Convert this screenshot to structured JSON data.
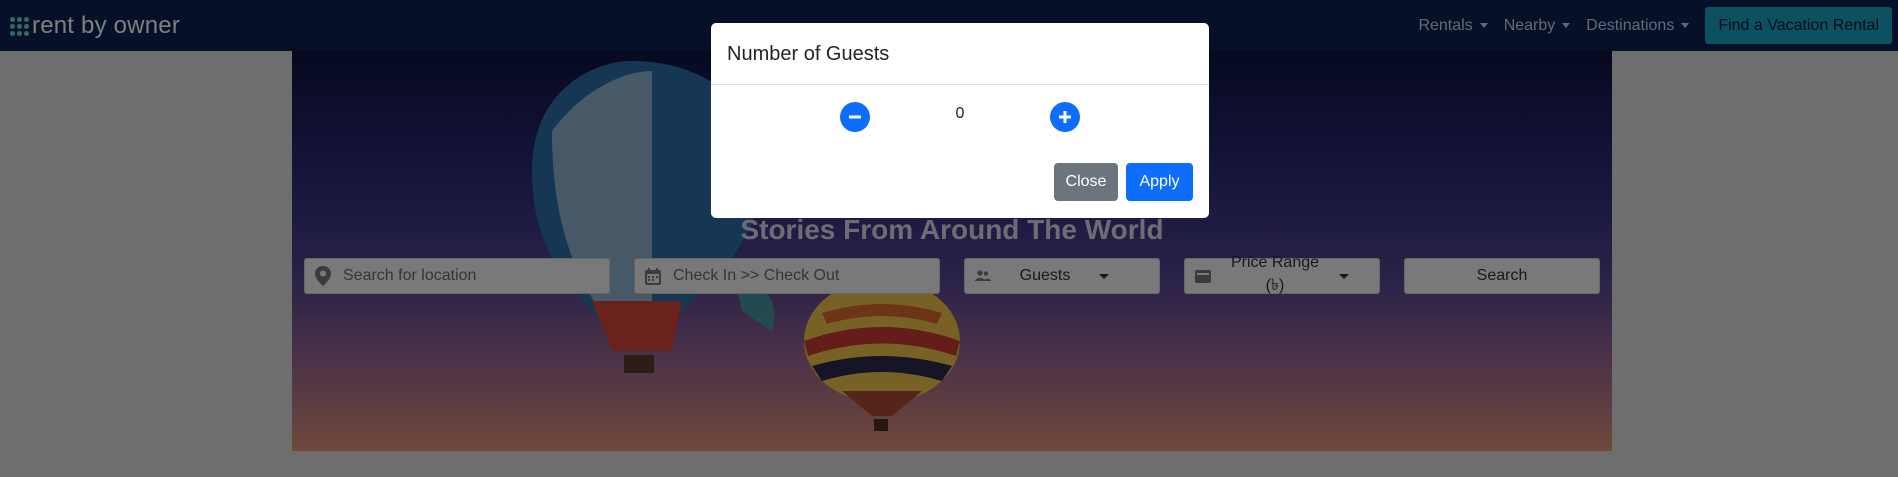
{
  "brand": {
    "name": "rent by owner"
  },
  "nav": {
    "items": [
      {
        "label": "Rentals"
      },
      {
        "label": "Nearby"
      },
      {
        "label": "Destinations"
      }
    ],
    "cta_label": "Find a Vacation Rental"
  },
  "hero": {
    "heading": "Stories From Around The World"
  },
  "search": {
    "location_placeholder": "Search for location",
    "dates_placeholder": "Check In >> Check Out",
    "guests_label": "Guests",
    "price_label": "Price Range (৳)",
    "search_label": "Search"
  },
  "modal": {
    "title": "Number of Guests",
    "count": "0",
    "close_label": "Close",
    "apply_label": "Apply"
  },
  "colors": {
    "navbar": "#0d2050",
    "cta": "#19a3c0",
    "primary": "#0d6efd",
    "secondary": "#6c757d"
  },
  "icons": [
    "logo-grid-icon",
    "map-pin-icon",
    "calendar-icon",
    "users-icon",
    "wallet-icon",
    "minus-icon",
    "plus-icon",
    "chevron-down-icon"
  ]
}
